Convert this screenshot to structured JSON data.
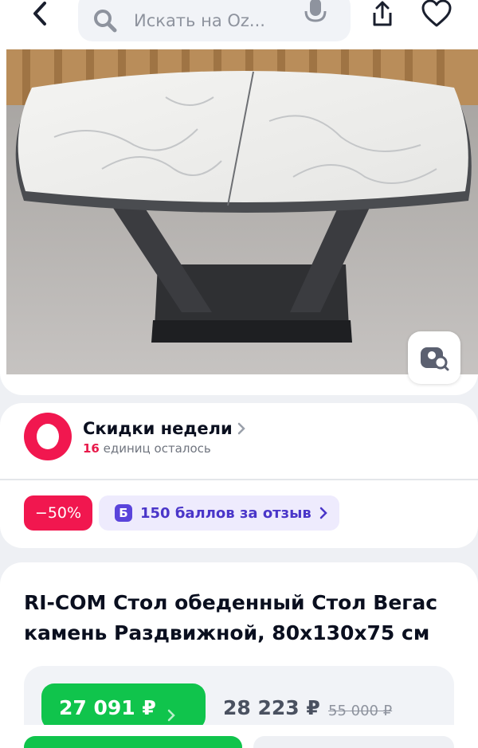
{
  "header": {
    "search_placeholder": "Искать на Oz..."
  },
  "promo": {
    "title": "Скидки недели",
    "remaining_count": "16",
    "remaining_text": " единиц осталось",
    "discount_badge": "−50%",
    "points_icon": "Б",
    "points_text": "150 баллов за отзыв"
  },
  "product": {
    "title": "RI-COM Стол обеденный Стол Вегас камень Раздвижной, 80х130х75 см",
    "price_card": "27 091 ₽",
    "price_regular": "28 223 ₽",
    "price_old": "55 000 ₽"
  },
  "colors": {
    "accent_green": "#10c44c",
    "discount_red": "#f1174f",
    "points_purple": "#4a36c9"
  },
  "icons": [
    "back-arrow-icon",
    "search-icon",
    "microphone-icon",
    "share-icon",
    "heart-icon",
    "visual-search-icon",
    "chevron-right-icon",
    "promo-ring-logo"
  ]
}
